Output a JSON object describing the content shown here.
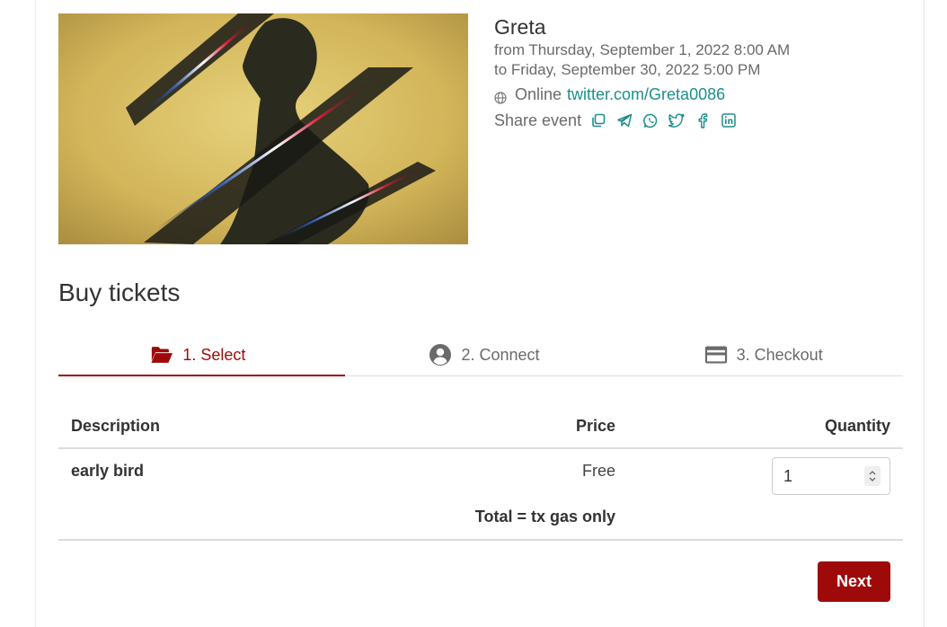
{
  "event": {
    "title": "Greta",
    "date_from": "from Thursday, September 1, 2022 8:00 AM",
    "date_to": "to Friday, September 30, 2022 5:00 PM",
    "location_type": "Online",
    "location_link": "twitter.com/Greta0086",
    "share_label": "Share event",
    "share_icons": [
      "copy-icon",
      "telegram-icon",
      "whatsapp-icon",
      "twitter-icon",
      "facebook-icon",
      "linkedin-icon"
    ],
    "image_icon": "event-poster-silhouette"
  },
  "buy": {
    "title": "Buy tickets",
    "steps": [
      {
        "label": "1. Select",
        "icon": "folder-open-icon",
        "active": true
      },
      {
        "label": "2. Connect",
        "icon": "user-circle-icon",
        "active": false
      },
      {
        "label": "3. Checkout",
        "icon": "credit-card-icon",
        "active": false
      }
    ],
    "table": {
      "headers": {
        "description": "Description",
        "price": "Price",
        "quantity": "Quantity"
      },
      "rows": [
        {
          "description": "early bird",
          "price": "Free",
          "quantity": "1"
        }
      ],
      "total": "Total = tx gas only"
    },
    "next_label": "Next"
  },
  "colors": {
    "accent": "#9e0a0a",
    "link": "#1c8f8a",
    "muted_text": "#6a6a6a",
    "text": "#333333",
    "border": "#dddddd"
  }
}
